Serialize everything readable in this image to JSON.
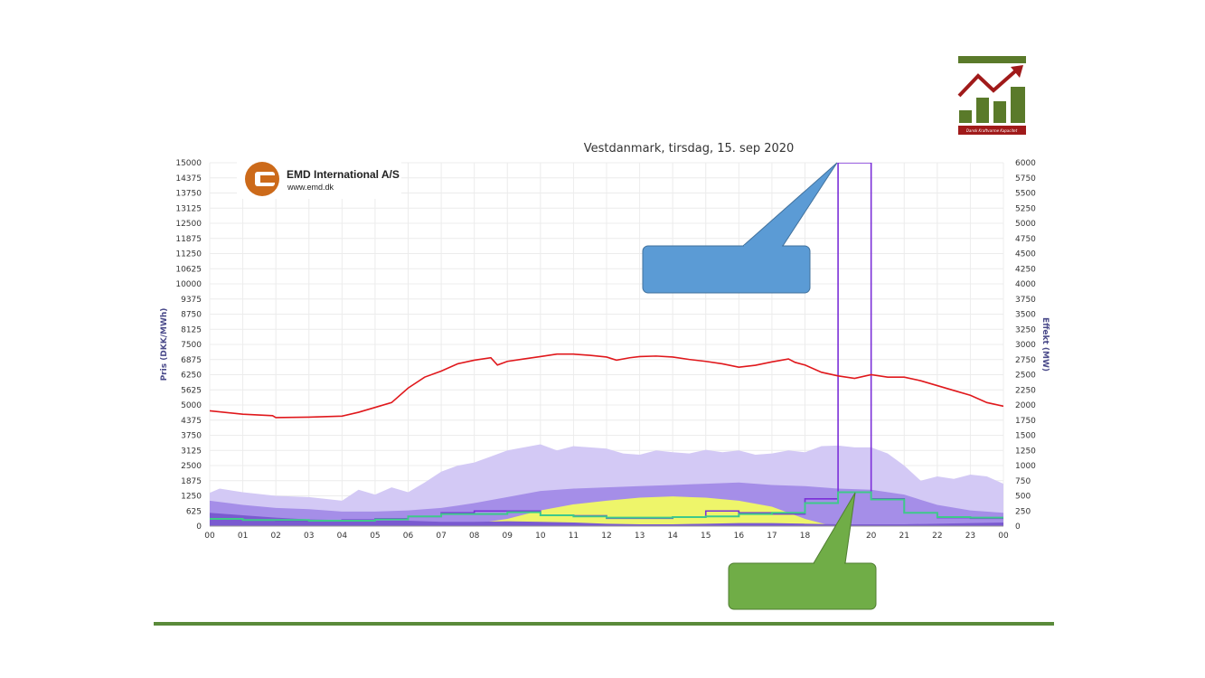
{
  "logo": {
    "brand_text": "Dansk Kraftvarme Kapacitet",
    "colors": {
      "green": "#5a7a2a",
      "red": "#a01a1a"
    }
  },
  "emd": {
    "name": "EMD International A/S",
    "url": "www.emd.dk",
    "colors": {
      "orange": "#cc6a1a"
    }
  },
  "callouts": {
    "blue": {
      "color": "#5b9bd5",
      "text": ""
    },
    "green": {
      "color": "#70ad47",
      "text": ""
    }
  },
  "footer_line_color": "#5a8a3a",
  "chart_data": {
    "type": "area",
    "title": "Vestdanmark, tirsdag, 15. sep 2020",
    "ylabel_left": "Pris (DKK/MWh)",
    "ylabel_right": "Effekt (MW)",
    "x_ticks": [
      "00",
      "01",
      "02",
      "03",
      "04",
      "05",
      "06",
      "07",
      "08",
      "09",
      "10",
      "11",
      "12",
      "13",
      "14",
      "15",
      "16",
      "17",
      "18",
      "19",
      "20",
      "21",
      "22",
      "23",
      "00"
    ],
    "y_left_ticks": [
      "15000",
      "14375",
      "13750",
      "13125",
      "12500",
      "11875",
      "11250",
      "10625",
      "10000",
      "9375",
      "8750",
      "8125",
      "7500",
      "6875",
      "6250",
      "5625",
      "5000",
      "4375",
      "3750",
      "3125",
      "2500",
      "1875",
      "1250",
      "625",
      "0"
    ],
    "y_right_ticks": [
      "6000",
      "5750",
      "5500",
      "5250",
      "5000",
      "4750",
      "4500",
      "4250",
      "4000",
      "3750",
      "3500",
      "3250",
      "3000",
      "2750",
      "2500",
      "2250",
      "2000",
      "1750",
      "1500",
      "1250",
      "1000",
      "750",
      "500",
      "250",
      "0"
    ],
    "ylim_left": [
      0,
      15000
    ],
    "ylim_right": [
      0,
      6000
    ],
    "xlim": [
      0,
      24
    ],
    "grid": true,
    "series": [
      {
        "kind": "area",
        "axis": "right",
        "color": "#d3c9f5",
        "points": [
          [
            0,
            550
          ],
          [
            0.3,
            620
          ],
          [
            1,
            560
          ],
          [
            2,
            500
          ],
          [
            3,
            480
          ],
          [
            4,
            420
          ],
          [
            4.5,
            600
          ],
          [
            5,
            520
          ],
          [
            5.5,
            640
          ],
          [
            6,
            560
          ],
          [
            6.5,
            720
          ],
          [
            7,
            900
          ],
          [
            7.5,
            1000
          ],
          [
            8,
            1050
          ],
          [
            8.5,
            1150
          ],
          [
            9,
            1250
          ],
          [
            9.5,
            1300
          ],
          [
            10,
            1350
          ],
          [
            10.5,
            1250
          ],
          [
            11,
            1320
          ],
          [
            11.5,
            1300
          ],
          [
            12,
            1280
          ],
          [
            12.5,
            1200
          ],
          [
            13,
            1180
          ],
          [
            13.5,
            1250
          ],
          [
            14,
            1220
          ],
          [
            14.5,
            1200
          ],
          [
            15,
            1260
          ],
          [
            15.5,
            1220
          ],
          [
            16,
            1250
          ],
          [
            16.5,
            1180
          ],
          [
            17,
            1200
          ],
          [
            17.5,
            1250
          ],
          [
            18,
            1220
          ],
          [
            18.5,
            1320
          ],
          [
            19,
            1330
          ],
          [
            19.5,
            1300
          ],
          [
            20,
            1300
          ],
          [
            20.5,
            1200
          ],
          [
            21,
            1000
          ],
          [
            21.5,
            750
          ],
          [
            22,
            820
          ],
          [
            22.5,
            780
          ],
          [
            23,
            850
          ],
          [
            23.5,
            820
          ],
          [
            24,
            700
          ]
        ]
      },
      {
        "kind": "area",
        "axis": "right",
        "color": "#a58ee8",
        "points": [
          [
            0,
            420
          ],
          [
            1,
            350
          ],
          [
            2,
            300
          ],
          [
            3,
            280
          ],
          [
            4,
            240
          ],
          [
            5,
            240
          ],
          [
            6,
            260
          ],
          [
            7,
            300
          ],
          [
            8,
            380
          ],
          [
            9,
            480
          ],
          [
            10,
            580
          ],
          [
            11,
            620
          ],
          [
            12,
            640
          ],
          [
            13,
            660
          ],
          [
            14,
            680
          ],
          [
            15,
            700
          ],
          [
            16,
            720
          ],
          [
            17,
            680
          ],
          [
            18,
            660
          ],
          [
            19,
            620
          ],
          [
            20,
            600
          ],
          [
            21,
            520
          ],
          [
            22,
            350
          ],
          [
            23,
            260
          ],
          [
            24,
            220
          ]
        ]
      },
      {
        "kind": "area",
        "axis": "right",
        "color": "#eef56a",
        "points": [
          [
            7,
            0
          ],
          [
            8,
            40
          ],
          [
            9,
            120
          ],
          [
            10,
            260
          ],
          [
            11,
            360
          ],
          [
            12,
            420
          ],
          [
            13,
            470
          ],
          [
            14,
            490
          ],
          [
            15,
            470
          ],
          [
            16,
            420
          ],
          [
            17,
            320
          ],
          [
            18,
            120
          ],
          [
            18.7,
            20
          ],
          [
            19,
            0
          ]
        ]
      },
      {
        "kind": "area",
        "axis": "right",
        "color": "#7a5ad0",
        "points": [
          [
            0,
            220
          ],
          [
            1,
            180
          ],
          [
            2,
            140
          ],
          [
            3,
            110
          ],
          [
            4,
            100
          ],
          [
            5,
            90
          ],
          [
            6,
            90
          ],
          [
            7,
            70
          ],
          [
            8,
            70
          ],
          [
            9,
            80
          ],
          [
            10,
            70
          ],
          [
            11,
            60
          ],
          [
            12,
            40
          ],
          [
            13,
            30
          ],
          [
            14,
            30
          ],
          [
            15,
            40
          ],
          [
            16,
            50
          ],
          [
            17,
            50
          ],
          [
            18,
            40
          ],
          [
            19,
            30
          ],
          [
            20,
            30
          ],
          [
            21,
            30
          ],
          [
            22,
            40
          ],
          [
            23,
            50
          ],
          [
            24,
            60
          ]
        ]
      },
      {
        "kind": "step",
        "axis": "right",
        "color": "#7b2fd8",
        "width": 1.6,
        "values": [
          120,
          100,
          90,
          90,
          100,
          120,
          160,
          220,
          250,
          250,
          180,
          170,
          130,
          130,
          150,
          250,
          220,
          200,
          450,
          6000,
          450,
          220,
          140,
          130
        ]
      },
      {
        "kind": "step",
        "axis": "right",
        "color": "#3ec98a",
        "width": 2,
        "values": [
          120,
          100,
          100,
          90,
          90,
          110,
          160,
          200,
          200,
          230,
          180,
          160,
          140,
          140,
          150,
          160,
          200,
          220,
          380,
          560,
          440,
          220,
          150,
          140
        ]
      },
      {
        "kind": "line",
        "axis": "left",
        "color": "#e0181c",
        "width": 1.6,
        "points": [
          [
            0,
            4760
          ],
          [
            1,
            4620
          ],
          [
            1.9,
            4560
          ],
          [
            2,
            4480
          ],
          [
            3,
            4500
          ],
          [
            4,
            4540
          ],
          [
            4.5,
            4700
          ],
          [
            5,
            4900
          ],
          [
            5.5,
            5100
          ],
          [
            6,
            5700
          ],
          [
            6.5,
            6150
          ],
          [
            7,
            6400
          ],
          [
            7.5,
            6700
          ],
          [
            8,
            6850
          ],
          [
            8.5,
            6950
          ],
          [
            8.7,
            6650
          ],
          [
            9,
            6800
          ],
          [
            9.5,
            6900
          ],
          [
            10,
            7000
          ],
          [
            10.5,
            7100
          ],
          [
            11,
            7100
          ],
          [
            11.5,
            7050
          ],
          [
            12,
            6980
          ],
          [
            12.3,
            6850
          ],
          [
            12.7,
            6950
          ],
          [
            13,
            7000
          ],
          [
            13.5,
            7020
          ],
          [
            14,
            6980
          ],
          [
            14.5,
            6880
          ],
          [
            15,
            6800
          ],
          [
            15.5,
            6700
          ],
          [
            16,
            6560
          ],
          [
            16.5,
            6640
          ],
          [
            17,
            6780
          ],
          [
            17.5,
            6900
          ],
          [
            17.7,
            6760
          ],
          [
            18,
            6650
          ],
          [
            18.5,
            6350
          ],
          [
            19,
            6200
          ],
          [
            19.5,
            6100
          ],
          [
            20,
            6250
          ],
          [
            20.5,
            6150
          ],
          [
            21,
            6150
          ],
          [
            21.5,
            6000
          ],
          [
            22,
            5800
          ],
          [
            22.5,
            5600
          ],
          [
            23,
            5400
          ],
          [
            23.5,
            5100
          ],
          [
            24,
            4950
          ]
        ]
      }
    ]
  }
}
